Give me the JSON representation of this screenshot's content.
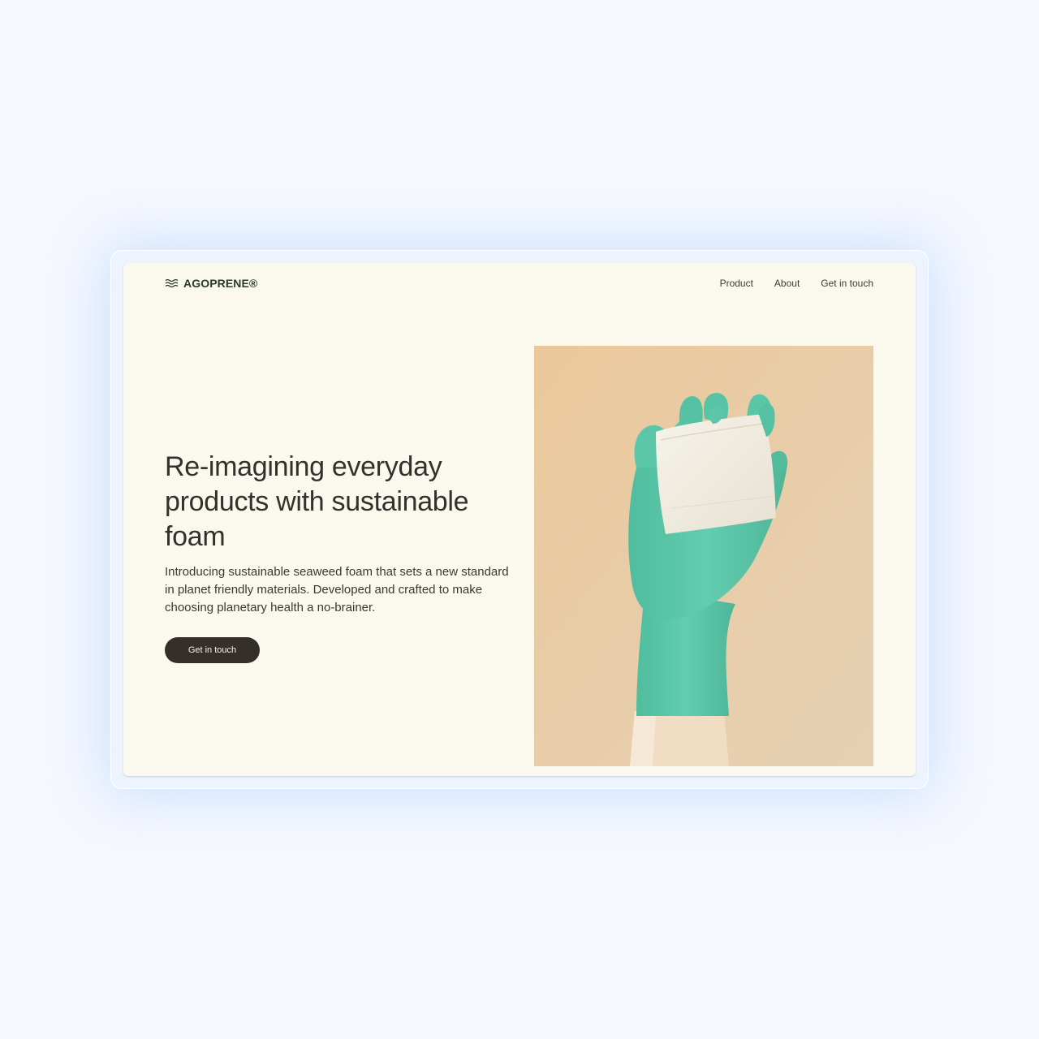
{
  "brand": {
    "name": "AGOPRENE®",
    "logo_icon": "waves-icon"
  },
  "nav": {
    "items": [
      {
        "label": "Product"
      },
      {
        "label": "About"
      },
      {
        "label": "Get in touch"
      }
    ]
  },
  "hero": {
    "title": "Re-imagining everyday products with sustainable foam",
    "description": "Introducing sustainable seaweed foam that sets a new standard in planet friendly materials. Developed and crafted to make choosing planetary health a no-brainer.",
    "cta_label": "Get in touch",
    "image": "gloved-hand-holding-foam-image"
  },
  "colors": {
    "page_background": "#fbf8ee",
    "text": "#33302d",
    "button": "#352f2c",
    "image_background": "#ebcba1",
    "glove": "#5ccaaa",
    "foam": "#f2eee4"
  }
}
